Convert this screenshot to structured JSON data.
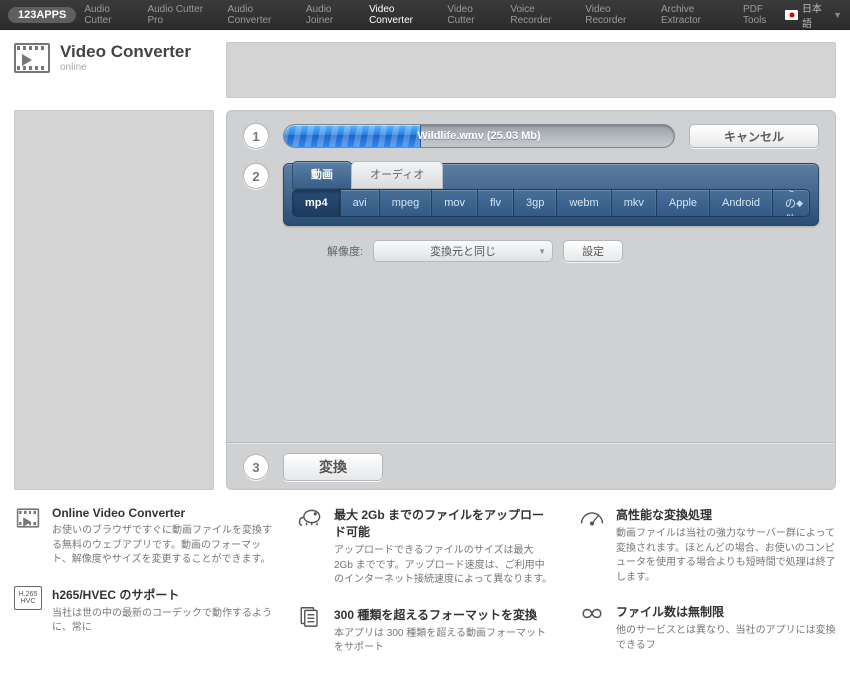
{
  "nav": {
    "logo": "123APPS",
    "items": [
      "Audio Cutter",
      "Audio Cutter Pro",
      "Audio Converter",
      "Audio Joiner",
      "Video Converter",
      "Video Cutter",
      "Voice Recorder",
      "Video Recorder",
      "Archive Extractor",
      "PDF Tools"
    ],
    "active_index": 4,
    "language": "日本語"
  },
  "title": {
    "main": "Video Converter",
    "sub": "online"
  },
  "steps": {
    "s1": {
      "num": "1",
      "file_label": "Wildlife.wmv (25.03 Mb)",
      "progress_pct": 35,
      "cancel": "キャンセル"
    },
    "s2": {
      "num": "2",
      "tabs": {
        "video": "動画",
        "audio": "オーディオ"
      },
      "formats": [
        "mp4",
        "avi",
        "mpeg",
        "mov",
        "flv",
        "3gp",
        "webm",
        "mkv",
        "Apple",
        "Android",
        "その他"
      ],
      "active_format_index": 0,
      "resolution_label": "解像度:",
      "resolution_value": "変換元と同じ",
      "settings": "設定"
    },
    "s3": {
      "num": "3",
      "convert": "変換"
    }
  },
  "features": {
    "f1": {
      "title": "Online Video Converter",
      "desc": "お使いのブラウザですぐに動画ファイルを変換する無料のウェブアプリです。動画のフォーマット、解像度やサイズを変更することができます。"
    },
    "f2": {
      "title": "最大 2Gb までのファイルをアップロード可能",
      "desc": "アップロードできるファイルのサイズは最大 2Gb までです。アップロード速度は、ご利用中のインターネット接続速度によって異なります。"
    },
    "f3": {
      "title": "高性能な変換処理",
      "desc": "動画ファイルは当社の強力なサーバー群によって変換されます。ほとんどの場合、お使いのコンピュータを使用する場合よりも短時間で処理は終了します。"
    },
    "f4": {
      "title": "h265/HVEC のサポート",
      "desc": "当社は世の中の最新のコーデックで動作するように、常に"
    },
    "f5": {
      "title": "300 種類を超えるフォーマットを変換",
      "desc": "本アプリは 300 種類を超える動画フォーマットをサポート"
    },
    "f6": {
      "title": "ファイル数は無制限",
      "desc": "他のサービスとは異なり、当社のアプリには変換できるフ"
    },
    "hvec_label": "H.265\nHVC"
  }
}
